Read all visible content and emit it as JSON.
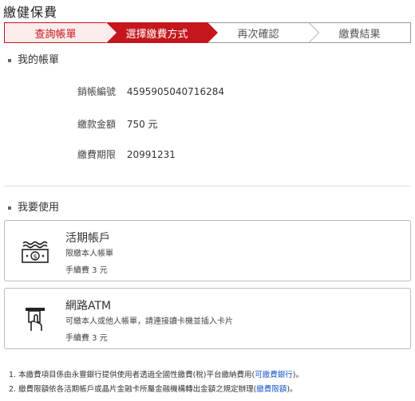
{
  "page": {
    "title": "繳健保費"
  },
  "steps": [
    {
      "label": "查詢帳單"
    },
    {
      "label": "選擇繳費方式"
    },
    {
      "label": "再次確認"
    },
    {
      "label": "繳費結果"
    }
  ],
  "account_section": {
    "heading": "我的帳單",
    "rows": [
      {
        "label": "銷帳編號",
        "value": "4595905040716284"
      },
      {
        "label": "繳款金額",
        "value": "750 元"
      },
      {
        "label": "繳費期限",
        "value": "20991231"
      }
    ]
  },
  "payment_section": {
    "heading": "我要使用",
    "options": [
      {
        "name": "活期帳戶",
        "desc": "限繳本人帳單",
        "fee": "手續費 3 元",
        "icon": "cash-icon"
      },
      {
        "name": "網路ATM",
        "desc": "可繳本人或他人帳單，請連接讀卡機並插入卡片",
        "fee": "手續費 3 元",
        "icon": "card-insert-icon"
      }
    ]
  },
  "notes": {
    "n1_prefix": "1.  本繳費項目係由永豐銀行提供使用者透過全國性繳費(稅)平台繳納費用(",
    "n1_link": "可繳費銀行",
    "n1_suffix": ")。",
    "n2_prefix": "2.  繳費限額依各活期帳戶或晶片金融卡所屬金融機構轉出金額之規定辦理(",
    "n2_link": "繳費限額",
    "n2_suffix": ")。"
  },
  "colors": {
    "accent": "#c4161c",
    "accent_light": "#fdecec",
    "link": "#1a57c9"
  }
}
